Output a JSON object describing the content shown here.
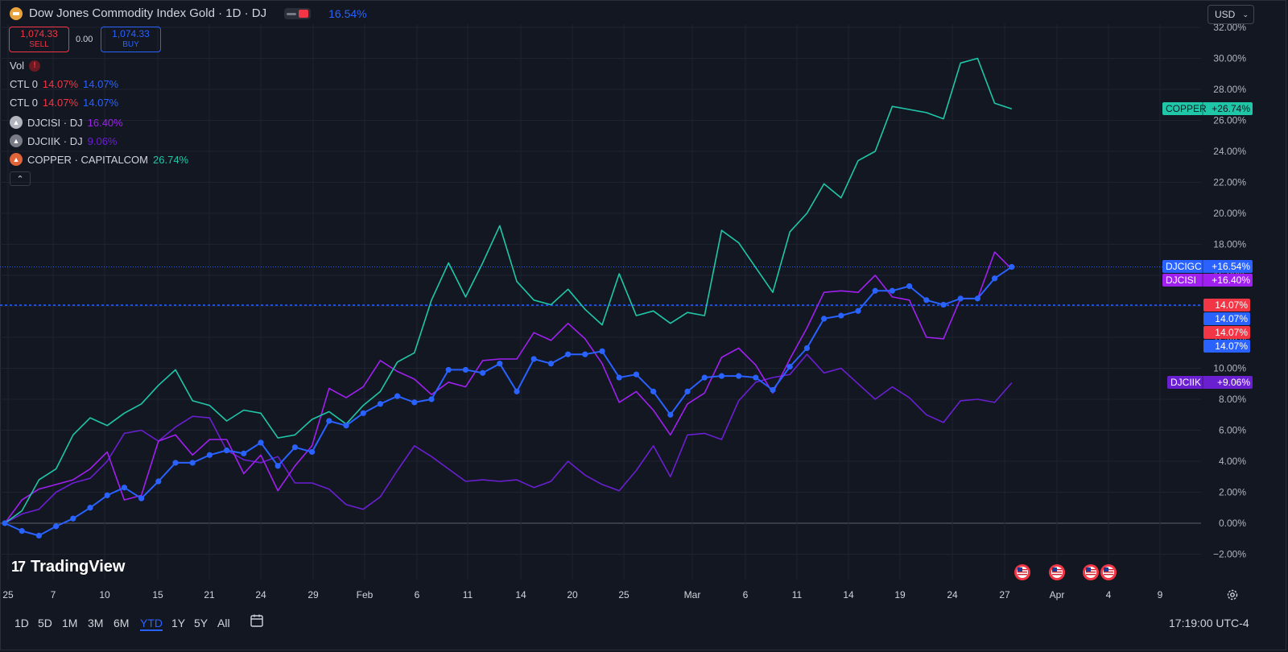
{
  "header": {
    "title": "Dow Jones Commodity Index Gold · 1D · DJ",
    "change_pct": "16.54%",
    "sell_price": "1,074.33",
    "sell_label": "SELL",
    "spread": "0.00",
    "buy_price": "1,074.33",
    "buy_label": "BUY",
    "currency": "USD"
  },
  "indicators": [
    {
      "label": "Vol"
    },
    {
      "label": "CTL 0",
      "v1": "14.07%",
      "v2": "14.07%"
    },
    {
      "label": "CTL 0",
      "v1": "14.07%",
      "v2": "14.07%"
    },
    {
      "label": "DJCISI · DJ",
      "value": "16.40%"
    },
    {
      "label": "DJCIIK · DJ",
      "value": "9.06%"
    },
    {
      "label": "COPPER · CAPITALCOM",
      "value": "26.74%"
    }
  ],
  "brand": "TradingView",
  "timeframes": [
    "1D",
    "5D",
    "1M",
    "3M",
    "6M",
    "YTD",
    "1Y",
    "5Y",
    "All"
  ],
  "active_timeframe": "YTD",
  "clock": "17:19:00 UTC-4",
  "icons": {
    "settings": "gear-icon",
    "calendar": "calendar-range-icon",
    "events": "us-flag-icon"
  },
  "colors": {
    "background": "#131722",
    "grid": "#1f2330",
    "djcigc": "#2962ff",
    "djcisi": "#a020f0",
    "djciik": "#6a1fd1",
    "copper": "#1fc7a8",
    "ctl_red": "#f23645"
  },
  "chart_data": {
    "type": "line",
    "y_unit": "%",
    "ylim": [
      -3,
      33
    ],
    "y_ticks": [
      "32.00%",
      "30.00%",
      "28.00%",
      "26.00%",
      "24.00%",
      "22.00%",
      "20.00%",
      "18.00%",
      "16.00%",
      "14.00%",
      "12.00%",
      "10.00%",
      "8.00%",
      "6.00%",
      "4.00%",
      "2.00%",
      "0.00%",
      "−2.00%"
    ],
    "x_ticks": [
      "25",
      "7",
      "10",
      "15",
      "21",
      "24",
      "29",
      "Feb",
      "6",
      "11",
      "14",
      "20",
      "25",
      "Mar",
      "6",
      "11",
      "14",
      "19",
      "24",
      "27",
      "Apr",
      "4",
      "9"
    ],
    "grid": true,
    "legend_position": "top-left",
    "series": [
      {
        "name": "COPPER",
        "label": "COPPER",
        "badge": "+26.74%",
        "values": [
          0.0,
          0.8,
          2.8,
          3.5,
          5.7,
          6.8,
          6.3,
          7.1,
          7.7,
          8.9,
          9.9,
          7.9,
          7.6,
          6.6,
          7.3,
          7.1,
          5.5,
          5.7,
          6.7,
          7.2,
          6.4,
          7.6,
          8.5,
          10.4,
          11.0,
          14.4,
          16.8,
          14.6,
          16.8,
          19.2,
          15.6,
          14.4,
          14.1,
          15.1,
          13.8,
          12.8,
          16.1,
          13.4,
          13.7,
          12.9,
          13.6,
          13.4,
          18.9,
          18.1,
          16.5,
          14.9,
          18.8,
          20.0,
          21.9,
          21.0,
          23.4,
          24.0,
          26.9,
          26.7,
          26.5,
          26.1,
          29.7,
          30.0,
          27.1,
          26.74
        ]
      },
      {
        "name": "DJCIGC",
        "label": "DJCIGC",
        "badge": "+16.54%",
        "values": [
          0.0,
          -0.5,
          -0.8,
          -0.2,
          0.3,
          1.0,
          1.8,
          2.3,
          1.6,
          2.7,
          3.9,
          3.9,
          4.4,
          4.7,
          4.5,
          5.2,
          3.7,
          4.9,
          4.6,
          6.6,
          6.3,
          7.1,
          7.7,
          8.2,
          7.8,
          8.0,
          9.9,
          9.9,
          9.7,
          10.3,
          8.5,
          10.6,
          10.3,
          10.9,
          10.9,
          11.1,
          9.4,
          9.6,
          8.5,
          7.0,
          8.5,
          9.4,
          9.5,
          9.5,
          9.4,
          8.6,
          10.1,
          11.3,
          13.2,
          13.4,
          13.7,
          15.0,
          15.0,
          15.3,
          14.4,
          14.1,
          14.5,
          14.5,
          15.8,
          16.54
        ]
      },
      {
        "name": "DJCISI",
        "label": "DJCISI",
        "badge": "+16.40%",
        "values": [
          0.0,
          1.5,
          2.2,
          2.5,
          2.8,
          3.5,
          4.6,
          1.5,
          1.8,
          5.3,
          5.7,
          4.4,
          5.4,
          5.4,
          3.2,
          4.4,
          2.1,
          3.7,
          5.0,
          8.7,
          8.1,
          8.8,
          10.5,
          9.8,
          9.3,
          8.3,
          9.1,
          8.8,
          10.5,
          10.6,
          10.6,
          12.3,
          11.8,
          12.9,
          11.9,
          10.3,
          7.8,
          8.5,
          7.3,
          5.7,
          7.7,
          8.4,
          10.7,
          11.3,
          10.2,
          8.4,
          10.6,
          12.6,
          14.9,
          15.0,
          14.9,
          16.0,
          14.6,
          14.4,
          12.0,
          11.9,
          14.5,
          14.5,
          17.5,
          16.4
        ]
      },
      {
        "name": "DJCIIK",
        "label": "DJCIIK",
        "badge": "+9.06%",
        "values": [
          0.0,
          0.6,
          0.9,
          2.0,
          2.6,
          2.9,
          4.0,
          5.8,
          6.0,
          5.3,
          6.2,
          6.9,
          6.8,
          4.7,
          4.1,
          3.9,
          4.3,
          2.6,
          2.6,
          2.2,
          1.2,
          0.9,
          1.7,
          3.4,
          5.0,
          4.3,
          3.5,
          2.7,
          2.8,
          2.7,
          2.8,
          2.3,
          2.7,
          4.0,
          3.1,
          2.5,
          2.1,
          3.4,
          5.0,
          3.0,
          5.7,
          5.8,
          5.4,
          7.9,
          9.1,
          9.4,
          9.6,
          10.9,
          9.7,
          10.0,
          9.0,
          8.0,
          8.8,
          8.1,
          7.0,
          6.5,
          7.9,
          8.0,
          7.8,
          9.06
        ]
      }
    ],
    "ctl_lines": [
      {
        "label": "CTL 0",
        "value": 16.54,
        "style": "dotted",
        "color": "#2962ff"
      },
      {
        "label": "CTL 0",
        "value": 14.07,
        "style": "dashed",
        "color": "#2962ff"
      }
    ],
    "ctl_badges": [
      {
        "text": "14.07%",
        "color": "#f23645"
      },
      {
        "text": "14.07%",
        "color": "#2962ff"
      },
      {
        "text": "14.07%",
        "color": "#f23645"
      },
      {
        "text": "14.07%",
        "color": "#2962ff"
      }
    ],
    "event_markers": 4
  }
}
